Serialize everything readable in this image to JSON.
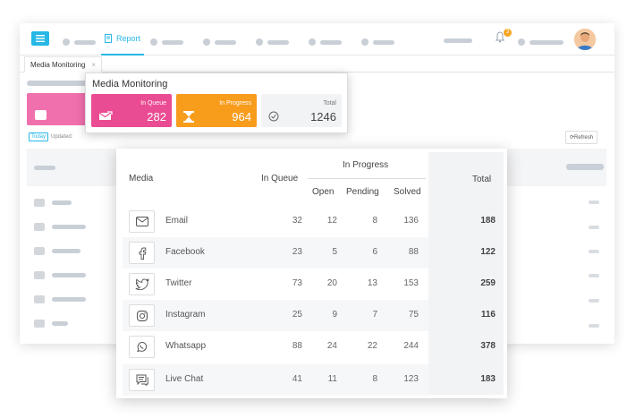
{
  "topbar": {
    "report_label": "Report",
    "bell_count": "3"
  },
  "tabs": [
    {
      "label": "Media Monitoring",
      "close": "×"
    }
  ],
  "filters": {
    "today_label": "Today",
    "updated_label": "Updated:"
  },
  "refresh_label": "Refresh",
  "summary": {
    "title": "Media Monitoring",
    "in_queue": {
      "label": "In Queue",
      "value": "282",
      "color": "#ea4c93"
    },
    "in_progress": {
      "label": "In Progress",
      "value": "964",
      "color": "#f89c1c"
    },
    "total": {
      "label": "Total",
      "value": "1246"
    }
  },
  "table": {
    "headers": {
      "media": "Media",
      "in_queue": "In Queue",
      "in_progress": "In Progress",
      "open": "Open",
      "pending": "Pending",
      "solved": "Solved",
      "total": "Total"
    },
    "rows": [
      {
        "icon": "email-icon",
        "name": "Email",
        "in_queue": "32",
        "open": "12",
        "pending": "8",
        "solved": "136",
        "total": "188"
      },
      {
        "icon": "facebook-icon",
        "name": "Facebook",
        "in_queue": "23",
        "open": "5",
        "pending": "6",
        "solved": "88",
        "total": "122"
      },
      {
        "icon": "twitter-icon",
        "name": "Twitter",
        "in_queue": "73",
        "open": "20",
        "pending": "13",
        "solved": "153",
        "total": "259"
      },
      {
        "icon": "instagram-icon",
        "name": "Instagram",
        "in_queue": "25",
        "open": "9",
        "pending": "7",
        "solved": "75",
        "total": "116"
      },
      {
        "icon": "whatsapp-icon",
        "name": "Whatsapp",
        "in_queue": "88",
        "open": "24",
        "pending": "22",
        "solved": "244",
        "total": "378"
      },
      {
        "icon": "live-chat-icon",
        "name": "Live Chat",
        "in_queue": "41",
        "open": "11",
        "pending": "8",
        "solved": "123",
        "total": "183"
      }
    ]
  },
  "colors": {
    "accent": "#27b8e6",
    "queue": "#ea4c93",
    "progress": "#f89c1c"
  }
}
